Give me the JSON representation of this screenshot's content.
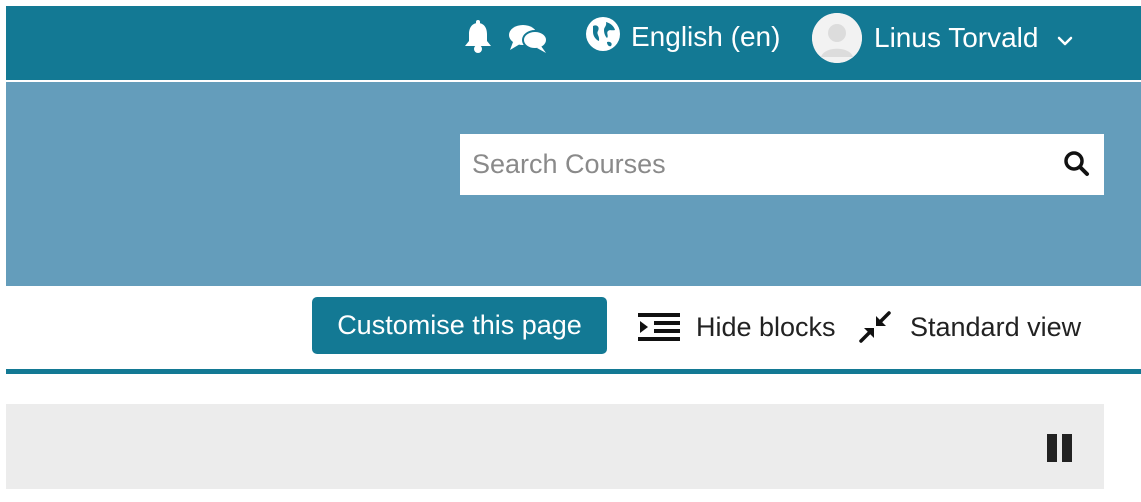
{
  "navbar": {
    "notifications_icon": "bell-icon",
    "messages_icon": "chat-bubbles-icon",
    "language_icon": "globe-icon",
    "language_label": "English (en)",
    "user_name": "Linus Torvald",
    "user_menu_icon": "chevron-down-icon",
    "bg_color": "#137994"
  },
  "header": {
    "bg_color": "#649dbb",
    "search": {
      "placeholder": "Search Courses",
      "value": "",
      "icon": "search-icon"
    }
  },
  "toolbar": {
    "customise_label": "Customise this page",
    "hide_blocks_label": "Hide blocks",
    "hide_blocks_icon": "outdent-icon",
    "standard_view_label": "Standard view",
    "standard_view_icon": "compress-icon",
    "accent_color": "#137994"
  },
  "block": {
    "bg_color": "#ececec",
    "control_icon": "pause-icon"
  }
}
